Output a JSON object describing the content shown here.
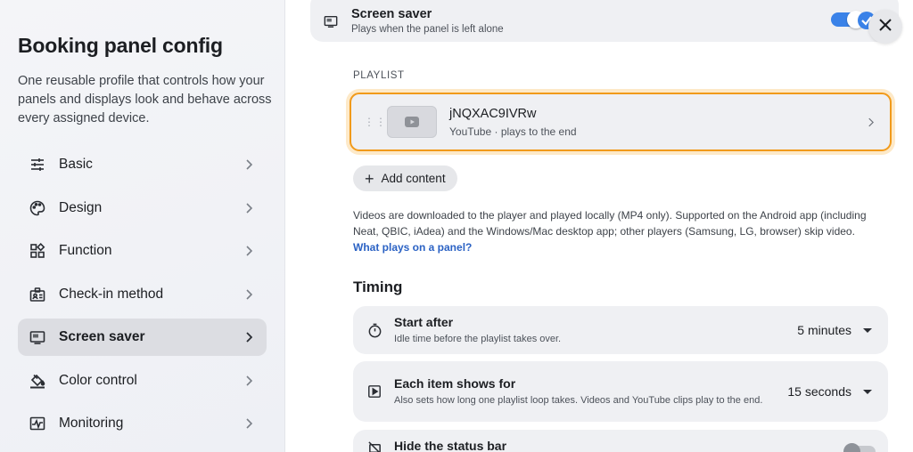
{
  "sidebar": {
    "title": "Booking panel config",
    "description": "One reusable profile that controls how your panels and displays look and behave across every assigned device.",
    "items": [
      {
        "label": "Basic",
        "icon": "sliders-icon"
      },
      {
        "label": "Design",
        "icon": "palette-icon"
      },
      {
        "label": "Function",
        "icon": "apps-icon"
      },
      {
        "label": "Check-in method",
        "icon": "badge-icon"
      },
      {
        "label": "Screen saver",
        "icon": "monitor-icon",
        "active": true
      },
      {
        "label": "Color control",
        "icon": "paint-bucket-icon"
      },
      {
        "label": "Monitoring",
        "icon": "activity-monitor-icon"
      }
    ]
  },
  "screen_saver_card": {
    "title": "Screen saver",
    "subtitle": "Plays when the panel is left alone",
    "enabled": true
  },
  "playlist": {
    "label": "PLAYLIST",
    "items": [
      {
        "title": "jNQXAC9IVRw",
        "subtitle": "YouTube · plays to the end"
      }
    ],
    "add_label": "Add content"
  },
  "info": {
    "text": "Videos are downloaded to the player and played locally (MP4 only). Supported on the Android app (including Neat, QBIC, iAdea) and the Windows/Mac desktop app; other players (Samsung, LG, browser) skip video. ",
    "link": "What plays on a panel?"
  },
  "timing": {
    "title": "Timing",
    "start_after": {
      "title": "Start after",
      "subtitle": "Idle time before the playlist takes over.",
      "value": "5 minutes"
    },
    "each_item": {
      "title": "Each item shows for",
      "subtitle": "Also sets how long one playlist loop takes. Videos and YouTube clips play to the end.",
      "value": "15 seconds"
    },
    "hide_status": {
      "title": "Hide the status bar",
      "enabled": false
    }
  },
  "colors": {
    "accent": "#3a82e8",
    "highlight": "#f19a1a",
    "link": "#2b62c4"
  }
}
